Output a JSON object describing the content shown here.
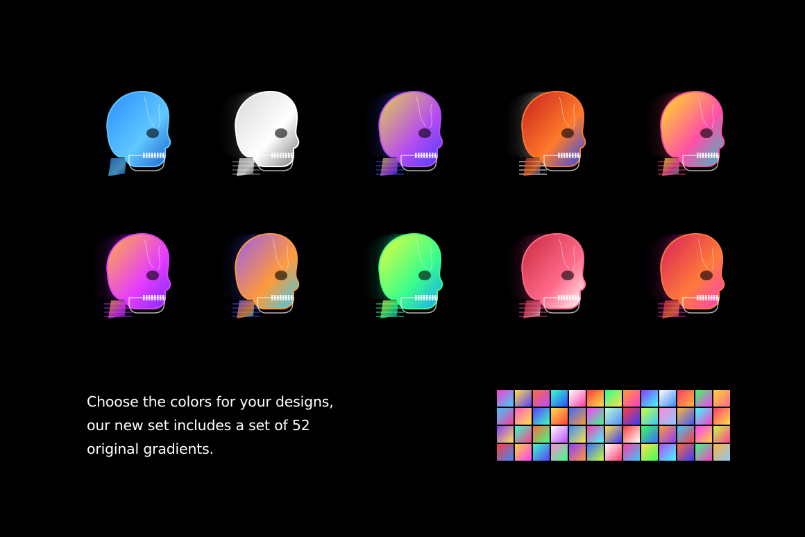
{
  "caption": {
    "line1": "Choose the colors for your designs,",
    "line2": "our new set includes a set of 52",
    "line3": "original gradients."
  },
  "colors": {
    "background": "#000000",
    "text": "#ffffff"
  },
  "skulls": [
    {
      "name": "blue-xray",
      "c1": "#2a8cff",
      "c2": "#5fc8ff",
      "c3": "#1b5fd0",
      "ghost": "#1b5fd0"
    },
    {
      "name": "grayscale",
      "c1": "#d8d8d8",
      "c2": "#ffffff",
      "c3": "#7a7a7a",
      "ghost": "#9a9a9a"
    },
    {
      "name": "violet-yellow",
      "c1": "#e4d24a",
      "c2": "#b64df0",
      "c3": "#4a3dff",
      "ghost": "#3a49ff"
    },
    {
      "name": "red-orange",
      "c1": "#c81e1e",
      "c2": "#ff7a2a",
      "c3": "#1f49ff",
      "ghost": "#ffffff"
    },
    {
      "name": "yellow-pink",
      "c1": "#ffe61a",
      "c2": "#ff4fa8",
      "c3": "#27c6c6",
      "ghost": "#ff3c64"
    },
    {
      "name": "magenta-orange",
      "c1": "#ffb43a",
      "c2": "#e63cff",
      "c3": "#7a2cff",
      "ghost": "#c61cff"
    },
    {
      "name": "purple-blue",
      "c1": "#9a5cf0",
      "c2": "#ff9a3a",
      "c3": "#2ad0ff",
      "ghost": "#3a4dff"
    },
    {
      "name": "green-lime",
      "c1": "#e8ff3a",
      "c2": "#3aff8a",
      "c3": "#1aa0ff",
      "ghost": "#18ffb0"
    },
    {
      "name": "pink-red",
      "c1": "#c8283c",
      "c2": "#ff6a8a",
      "c3": "#ffffff",
      "ghost": "#ff3c9a"
    },
    {
      "name": "crimson-magenta",
      "c1": "#d81e5a",
      "c2": "#ff7a3a",
      "c3": "#ff3cc8",
      "ghost": "#ff1cbe"
    }
  ],
  "swatches": [
    [
      "#ff3cc8",
      "#39d0ff"
    ],
    [
      "#ffe14a",
      "#5a3cff"
    ],
    [
      "#ff6a3a",
      "#b84aff"
    ],
    [
      "#3affc8",
      "#2a4dff"
    ],
    [
      "#ffffff",
      "#ff3ca8"
    ],
    [
      "#ff3c3c",
      "#ffe14a"
    ],
    [
      "#2aff8a",
      "#ffe14a"
    ],
    [
      "#ff9a3a",
      "#ff3cc8"
    ],
    [
      "#8a3cff",
      "#3affff"
    ],
    [
      "#ffffff",
      "#3a8aff"
    ],
    [
      "#ff3c6a",
      "#ffb43a"
    ],
    [
      "#3aff5a",
      "#ff3cff"
    ],
    [
      "#ffd23a",
      "#ff6a8a"
    ],
    [
      "#3ac8ff",
      "#ff3c9a"
    ],
    [
      "#ff5ac8",
      "#ffe14a"
    ],
    [
      "#5a3cff",
      "#3affc8"
    ],
    [
      "#ffe14a",
      "#ff3c3c"
    ],
    [
      "#3a6aff",
      "#ff9a3a"
    ],
    [
      "#ff3cff",
      "#3aff8a"
    ],
    [
      "#b4ffd2",
      "#5a8aff"
    ],
    [
      "#ff3c3c",
      "#3a3cff"
    ],
    [
      "#c8ff3a",
      "#3ac8ff"
    ],
    [
      "#ff8ad2",
      "#8ac8ff"
    ],
    [
      "#ffb43a",
      "#3a5aff"
    ],
    [
      "#3affff",
      "#ff3cc8"
    ],
    [
      "#ff3c6a",
      "#ffe14a"
    ],
    [
      "#8a3cff",
      "#ffe14a"
    ],
    [
      "#3affc8",
      "#ff3c8a"
    ],
    [
      "#ff6a3a",
      "#3aff8a"
    ],
    [
      "#ffffff",
      "#b84aff"
    ],
    [
      "#3a8aff",
      "#ffe14a"
    ],
    [
      "#ff3ca8",
      "#3affff"
    ],
    [
      "#ffe14a",
      "#3a3cff"
    ],
    [
      "#ff3c3c",
      "#ffffff"
    ],
    [
      "#3aff5a",
      "#3a6aff"
    ],
    [
      "#ff9a3a",
      "#8a3cff"
    ],
    [
      "#3ac8ff",
      "#ff3c3c"
    ],
    [
      "#ff3cff",
      "#ffd23a"
    ],
    [
      "#c8ff3a",
      "#ff3c9a"
    ],
    [
      "#ff3c3c",
      "#3a8aff"
    ],
    [
      "#ffd23a",
      "#ff3cff"
    ],
    [
      "#3affc8",
      "#5a3cff"
    ],
    [
      "#ff8ad2",
      "#3aff8a"
    ],
    [
      "#8a3cff",
      "#ff9a3a"
    ],
    [
      "#3a6aff",
      "#c8ff3a"
    ],
    [
      "#ffffff",
      "#ff3c6a"
    ],
    [
      "#ff3ca8",
      "#3ac8ff"
    ],
    [
      "#ffe14a",
      "#3aff5a"
    ],
    [
      "#b84aff",
      "#3affff"
    ],
    [
      "#ff6a3a",
      "#3a3cff"
    ],
    [
      "#3aff8a",
      "#ff3cc8"
    ],
    [
      "#ffb43a",
      "#8ac8ff"
    ]
  ]
}
